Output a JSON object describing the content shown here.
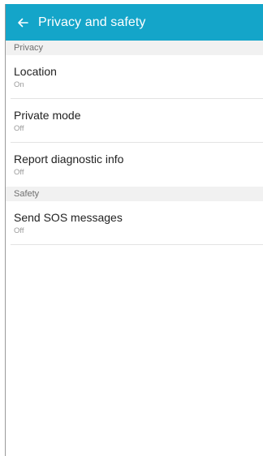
{
  "appbar": {
    "title": "Privacy and safety",
    "back_icon": "arrow-left-icon",
    "background_color": "#14a5c9"
  },
  "sections": {
    "privacy": {
      "header": "Privacy",
      "items": [
        {
          "title": "Location",
          "value": "On"
        },
        {
          "title": "Private mode",
          "value": "Off"
        },
        {
          "title": "Report diagnostic info",
          "value": "Off"
        }
      ]
    },
    "safety": {
      "header": "Safety",
      "items": [
        {
          "title": "Send SOS messages",
          "value": "Off"
        }
      ]
    }
  }
}
